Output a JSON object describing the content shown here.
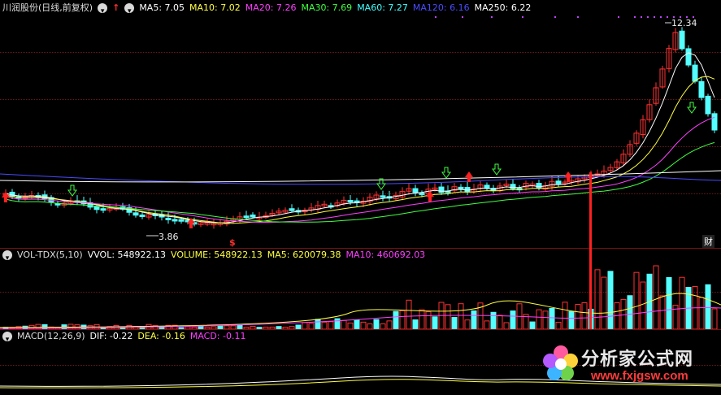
{
  "main": {
    "title": "川润股份(日线,前复权)",
    "ma_items": [
      {
        "label": "MA5: 7.05",
        "color": "#ffffff"
      },
      {
        "label": "MA10: 7.02",
        "color": "#ffff40"
      },
      {
        "label": "MA20: 7.26",
        "color": "#ff40ff"
      },
      {
        "label": "MA30: 7.69",
        "color": "#40ff40"
      },
      {
        "label": "MA60: 7.27",
        "color": "#40ffff"
      },
      {
        "label": "MA120: 6.16",
        "color": "#4040ff"
      },
      {
        "label": "MA250: 6.22",
        "color": "#ffffff"
      }
    ],
    "high_label": "12.34",
    "low_label": "3.86",
    "dollar_mark": "$",
    "cai_mark": "财"
  },
  "volume": {
    "title": "VOL-TDX(5,10)",
    "items": [
      {
        "label": "VVOL: 548922.13",
        "color": "#ffffff"
      },
      {
        "label": "VOLUME: 548922.13",
        "color": "#ffff40"
      },
      {
        "label": "MA5: 620079.38",
        "color": "#ffff40"
      },
      {
        "label": "MA10: 460692.03",
        "color": "#ff40ff"
      }
    ]
  },
  "macd": {
    "title": "MACD(12,26,9)",
    "items": [
      {
        "label": "DIF: -0.22",
        "color": "#ffffff"
      },
      {
        "label": "DEA: -0.16",
        "color": "#ffff40"
      },
      {
        "label": "MACD: -0.11",
        "color": "#ff40ff"
      }
    ]
  },
  "watermark": {
    "name": "分析家公式网",
    "url": "www.fxjgsw.com"
  },
  "colors": {
    "up": "#ff3232",
    "down": "#54ffff",
    "grid": "#6a1a1a"
  }
}
